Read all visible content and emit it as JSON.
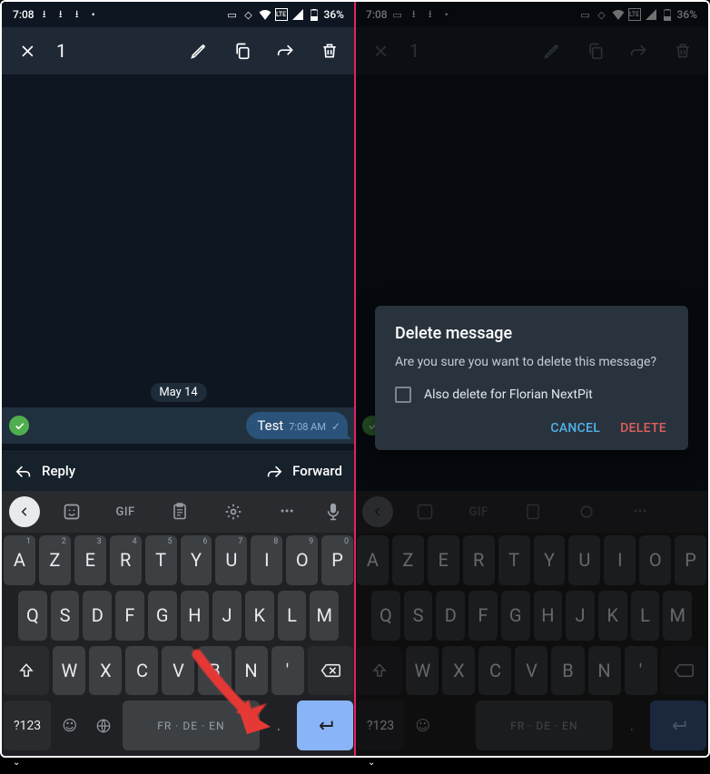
{
  "status": {
    "time": "7:08",
    "battery": "36%"
  },
  "actionbar": {
    "count": "1"
  },
  "chat": {
    "date": "May 14",
    "msg": "Test",
    "msgtime": "7:08 AM"
  },
  "rf": {
    "reply": "Reply",
    "forward": "Forward"
  },
  "kbd": {
    "gif": "GIF",
    "row1": [
      "A",
      "Z",
      "E",
      "R",
      "T",
      "Y",
      "U",
      "I",
      "O",
      "P"
    ],
    "sup1": [
      "1",
      "2",
      "3",
      "4",
      "5",
      "6",
      "7",
      "8",
      "9",
      "0"
    ],
    "row2": [
      "Q",
      "S",
      "D",
      "F",
      "G",
      "H",
      "J",
      "K",
      "L",
      "M"
    ],
    "row3": [
      "W",
      "X",
      "C",
      "V",
      "B",
      "N",
      "'"
    ],
    "sym": "?123",
    "space": "FR · DE · EN",
    "period": "."
  },
  "dialog": {
    "title": "Delete message",
    "body": "Are you sure you want to delete this message?",
    "also": "Also delete for Florian NextPit",
    "cancel": "CANCEL",
    "delete": "DELETE"
  }
}
